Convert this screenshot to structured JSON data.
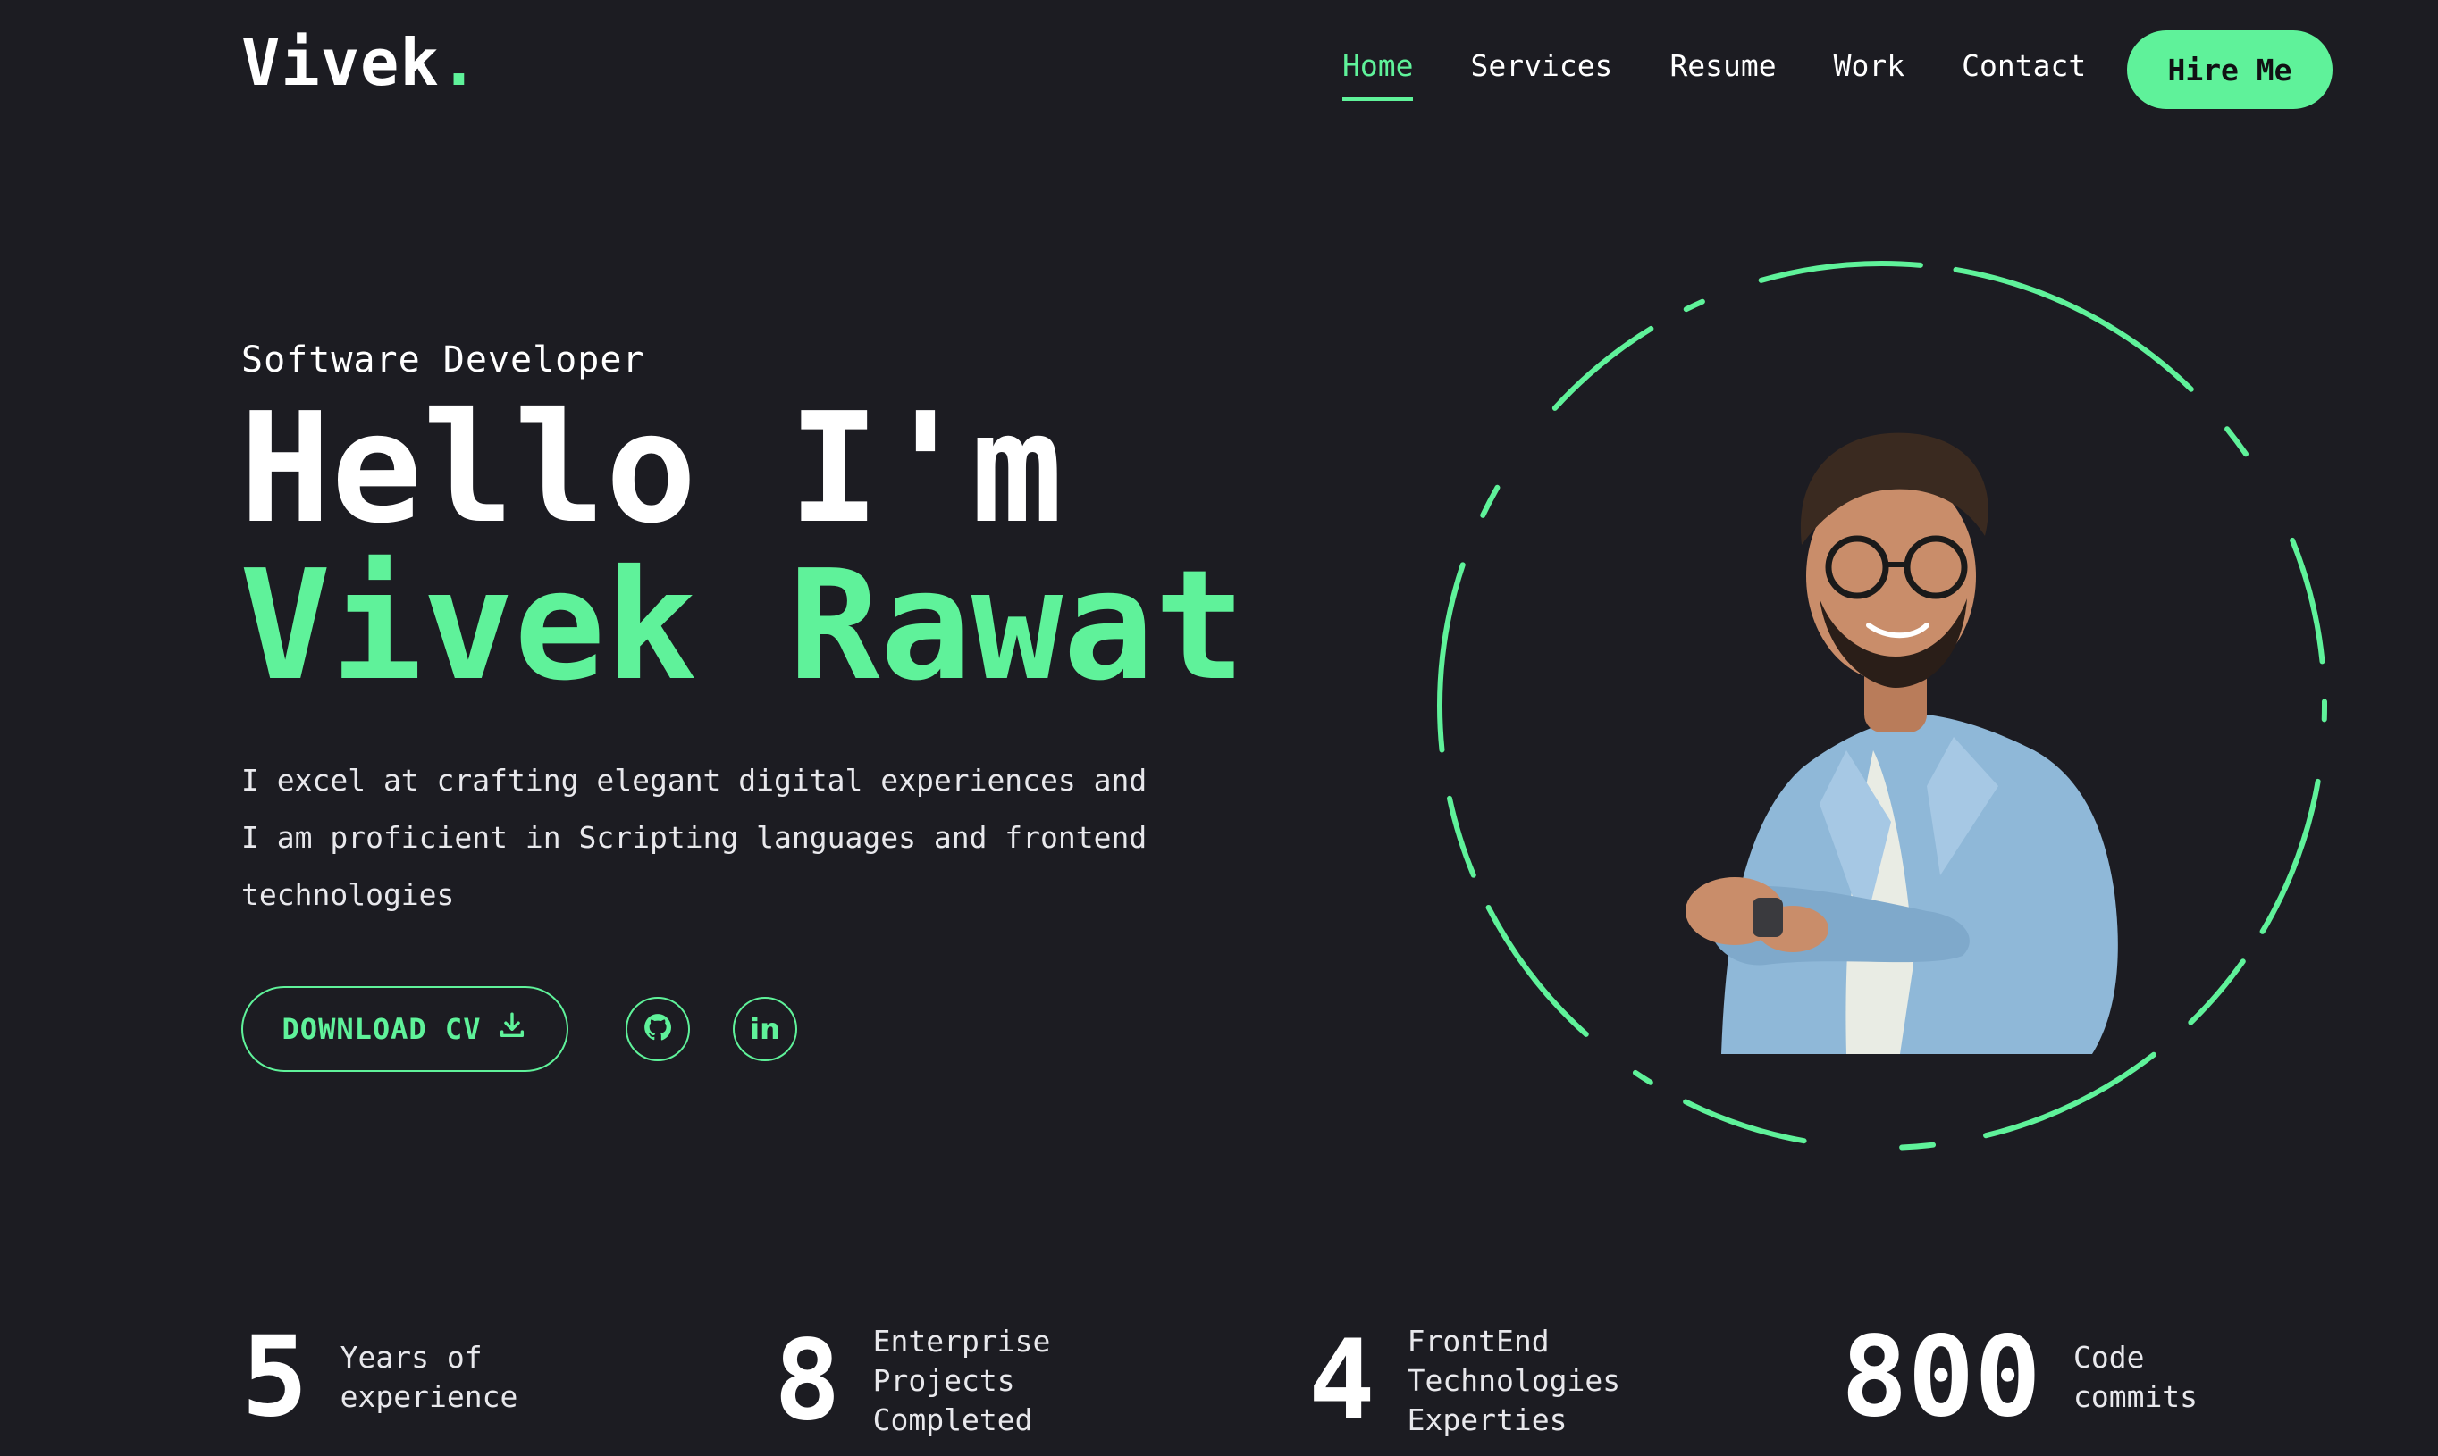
{
  "header": {
    "logo": "Vivek",
    "logo_dot": ".",
    "nav": [
      "Home",
      "Services",
      "Resume",
      "Work",
      "Contact"
    ],
    "active_nav": "Home",
    "hire_label": "Hire Me"
  },
  "hero": {
    "role": "Software Developer",
    "greeting": "Hello I'm",
    "name": "Vivek Rawat",
    "description": "I excel at crafting elegant digital experiences and I am proficient in Scripting languages and frontend technologies",
    "cv_label": "DOWNLOAD CV",
    "social_linkedin_text": "in"
  },
  "stats": [
    {
      "number": "5",
      "label_line1": "Years of",
      "label_line2": "experience",
      "label_line3": ""
    },
    {
      "number": "8",
      "label_line1": "Enterprise",
      "label_line2": "Projects",
      "label_line3": "Completed"
    },
    {
      "number": "4",
      "label_line1": "FrontEnd",
      "label_line2": "Technologies",
      "label_line3": "Experties"
    },
    {
      "number": "800",
      "label_line1": "Code",
      "label_line2": "commits",
      "label_line3": ""
    }
  ],
  "colors": {
    "background": "#1c1c22",
    "accent": "#5ff29a",
    "text": "#ffffff"
  },
  "icons": {
    "github": "github-icon",
    "linkedin": "linkedin-icon",
    "download": "download-icon"
  }
}
